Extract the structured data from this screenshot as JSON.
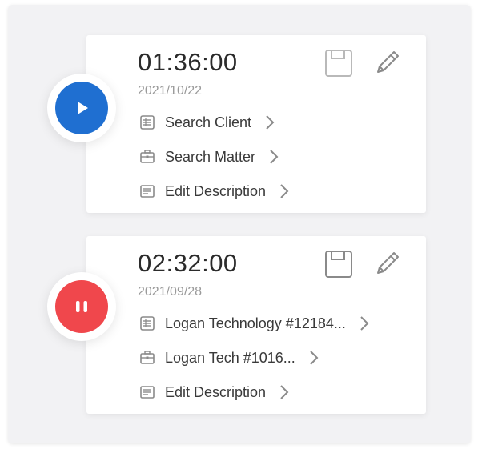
{
  "colors": {
    "play": "#1f6fd1",
    "pause": "#f0474c",
    "text": "#3a3a3a",
    "muted": "#9a9a9a",
    "icon": "#8a8a8a"
  },
  "entries": [
    {
      "timer": "01:36:00",
      "date": "2021/10/22",
      "state": "stopped",
      "control_icon": "play-icon",
      "client": "Search Client",
      "matter": "Search Matter",
      "description": "Edit Description",
      "save_icon": "save-icon",
      "edit_icon": "pencil-icon"
    },
    {
      "timer": "02:32:00",
      "date": "2021/09/28",
      "state": "running",
      "control_icon": "pause-icon",
      "client": "Logan Technology #12184...",
      "matter": "Logan Tech #1016...",
      "description": "Edit Description",
      "save_icon": "save-icon",
      "edit_icon": "pencil-icon"
    }
  ]
}
